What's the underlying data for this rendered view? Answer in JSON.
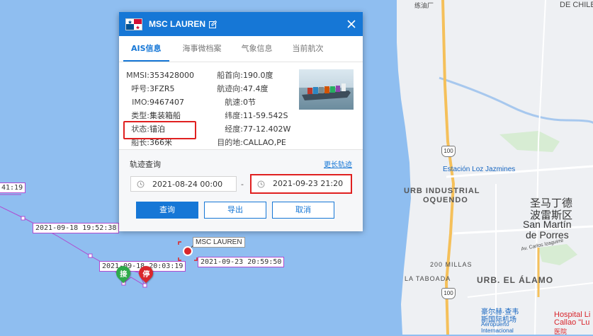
{
  "dialog": {
    "title": "MSC LAUREN",
    "tabs": [
      "AIS信息",
      "海事微档案",
      "气象信息",
      "当前航次"
    ],
    "info_left": [
      {
        "label": "MMSI:",
        "value": "353428000"
      },
      {
        "label": "呼号:",
        "value": "3FZR5"
      },
      {
        "label": "IMO:",
        "value": "9467407"
      },
      {
        "label": "类型:",
        "value": "集装箱船"
      },
      {
        "label": "状态:",
        "value": "锚泊"
      },
      {
        "label": "船长:",
        "value": "366米"
      }
    ],
    "info_right": [
      {
        "label": "船首向:",
        "value": "190.0度"
      },
      {
        "label": "航迹向:",
        "value": "47.4度"
      },
      {
        "label": "航速:",
        "value": "0节"
      },
      {
        "label": "纬度:",
        "value": "11-59.542S"
      },
      {
        "label": "经度:",
        "value": "77-12.402W"
      },
      {
        "label": "目的地:",
        "value": "CALLAO,PE"
      }
    ],
    "track": {
      "title": "轨迹查询",
      "more_link": "更长轨迹",
      "start_date": "2021-08-24 00:00",
      "end_date": "2021-09-23 21:20",
      "separator": "-",
      "buttons": {
        "query": "查询",
        "export": "导出",
        "cancel": "取消"
      }
    }
  },
  "map": {
    "ship_label": "MSC LAUREN",
    "track_tags": [
      "41:19",
      "2021-09-18 19:52:38",
      "2021-09-18 20:03:19",
      "2021-09-23 20:59:50"
    ],
    "start_pin": "接",
    "end_pin": "停",
    "place_labels": {
      "chile": "DE CHILE",
      "lianda": "练油厂",
      "jazmines": "Estación Loz Jazmines",
      "urb_industrial_1": "URB INDUSTRIAL",
      "urb_industrial_2": "OQUENDO",
      "san_martin_cn_1": "圣马丁德",
      "san_martin_cn_2": "波雷斯区",
      "san_martin_1": "San Martín",
      "san_martin_2": "de Porres",
      "millas": "200 MILLAS",
      "taboada": "LA TABOADA",
      "alamo": "URB. EL ÁLAMO",
      "airport_cn_1": "豪尔赫·查韦",
      "airport_cn_2": "斯国际机场",
      "airport_1": "Aeropuerto",
      "airport_2": "Internacional",
      "hospital_1": "Hospital Li",
      "hospital_2": "Callao \"Lu",
      "hospital_cn": "医院",
      "carlos": "Av. Carlos Izaguirre",
      "route": "100"
    }
  },
  "colors": {
    "accent": "#1677d6",
    "sea": "#8fbef0",
    "land": "#eef0f3",
    "track": "#b04ad0",
    "highlight": "#e02020",
    "start_pin": "#2eaa4a",
    "end_pin": "#d9262c"
  }
}
